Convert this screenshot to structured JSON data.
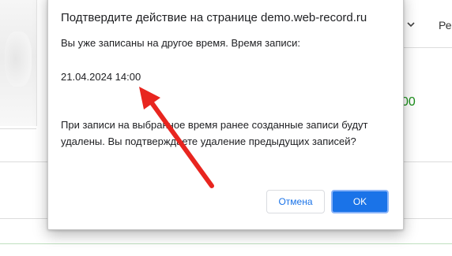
{
  "dialog": {
    "title": "Подтвердите действие на странице demo.web-record.ru",
    "message_line1": "Вы уже записаны на другое время. Время записи:",
    "appointment_time": "21.04.2024 14:00",
    "message_line2": "При записи на выбранное время ранее созданные записи будут удалены. Вы подтверждаете удаление предыдущих записей?",
    "cancel_label": "Отмена",
    "ok_label": "OK"
  },
  "background": {
    "partial_header_text": "Ре",
    "partial_price_text": "00"
  },
  "annotation": {
    "arrow_color": "#e8251f"
  },
  "colors": {
    "primary_button": "#1a73e8",
    "price_green": "#1a8f1a"
  }
}
